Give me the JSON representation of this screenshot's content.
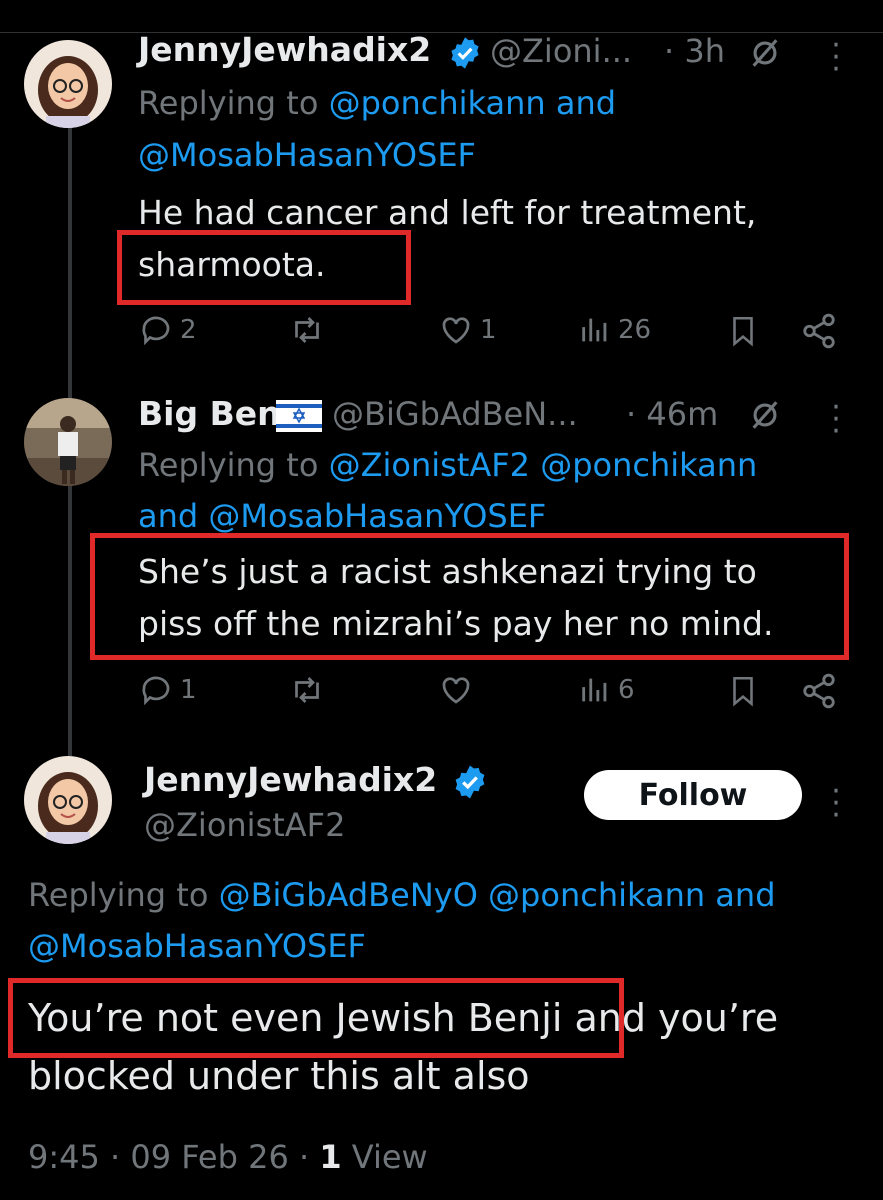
{
  "tweet1": {
    "name": "JennyJewhadix2",
    "handle": "@Zioni...",
    "time": "· 3h",
    "replying_prefix": "Replying to",
    "reply_to_1": "@ponchikann",
    "and": "and",
    "reply_to_2": "@MosabHasanYOSEF",
    "text_line1": "He had cancer and left for treatment,",
    "text_line2": "sharmoota.",
    "replies": "2",
    "retweets": "",
    "likes": "1",
    "views": "26"
  },
  "tweet2": {
    "name": "Big Ben",
    "handle": "@BiGbAdBeN...",
    "time": "· 46m",
    "replying_prefix": "Replying to",
    "reply_to_1": "@ZionistAF2",
    "reply_to_2": "@ponchikann",
    "and": "and",
    "reply_to_3": "@MosabHasanYOSEF",
    "text_line1": "She’s just a racist ashkenazi trying to",
    "text_line2": "piss off the mizrahi’s pay her no mind.",
    "replies": "1",
    "likes": "",
    "views": "6"
  },
  "tweet3": {
    "name": "JennyJewhadix2",
    "handle": "@ZionistAF2",
    "follow_label": "Follow",
    "replying_prefix": "Replying to",
    "reply_to_1": "@BiGbAdBeNyO",
    "reply_to_2": "@ponchikann",
    "and": "and",
    "reply_to_3": "@MosabHasanYOSEF",
    "text_highlight": "You’re not even Jewish Benji",
    "text_rest": " and you’re",
    "text_line2": "blocked under this alt also",
    "timestamp": "9:45 · 09 Feb 26 ·",
    "view_count": "1",
    "view_label": "View"
  },
  "colors": {
    "link": "#1d9bf0",
    "muted": "#71767b",
    "highlight_box": "#e02a2a",
    "verified": "#1d9bf0"
  }
}
